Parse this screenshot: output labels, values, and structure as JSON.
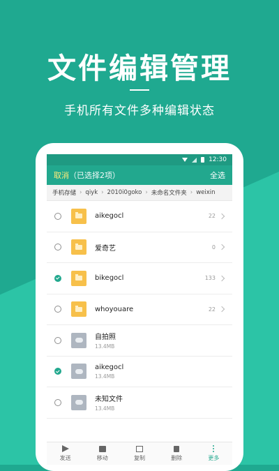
{
  "promo": {
    "headline": "文件编辑管理",
    "subtitle": "手机所有文件多种编辑状态"
  },
  "status_bar": {
    "time": "12:30"
  },
  "app_bar": {
    "cancel_label": "取消",
    "selected_text": "（已选择2项）",
    "select_all_label": "全选"
  },
  "breadcrumb": [
    "手机存储",
    "qiyk",
    "2010i0goko",
    "未命名文件夹",
    "weixin"
  ],
  "files": [
    {
      "name": "aikegocl",
      "type": "folder",
      "count": "22",
      "checked": false
    },
    {
      "name": "爱奇艺",
      "type": "folder",
      "count": "0",
      "checked": false
    },
    {
      "name": "bikegocl",
      "type": "folder",
      "count": "133",
      "checked": true
    },
    {
      "name": "whoyouare",
      "type": "folder",
      "count": "22",
      "checked": false
    },
    {
      "name": "自拍照",
      "type": "image",
      "size": "13.4MB",
      "checked": false
    },
    {
      "name": "aikegocl",
      "type": "image",
      "size": "13.4MB",
      "checked": true
    },
    {
      "name": "未知文件",
      "type": "image",
      "size": "13.4MB",
      "checked": false
    }
  ],
  "bottom_bar": [
    {
      "label": "发送",
      "icon": "send-icon"
    },
    {
      "label": "移动",
      "icon": "move-icon"
    },
    {
      "label": "复制",
      "icon": "copy-icon"
    },
    {
      "label": "删除",
      "icon": "delete-icon"
    },
    {
      "label": "更多",
      "icon": "more-icon"
    }
  ],
  "colors": {
    "accent": "#22a88e",
    "background": "#1fa990",
    "highlight": "#ffeb7a",
    "folder": "#f7c04a"
  }
}
